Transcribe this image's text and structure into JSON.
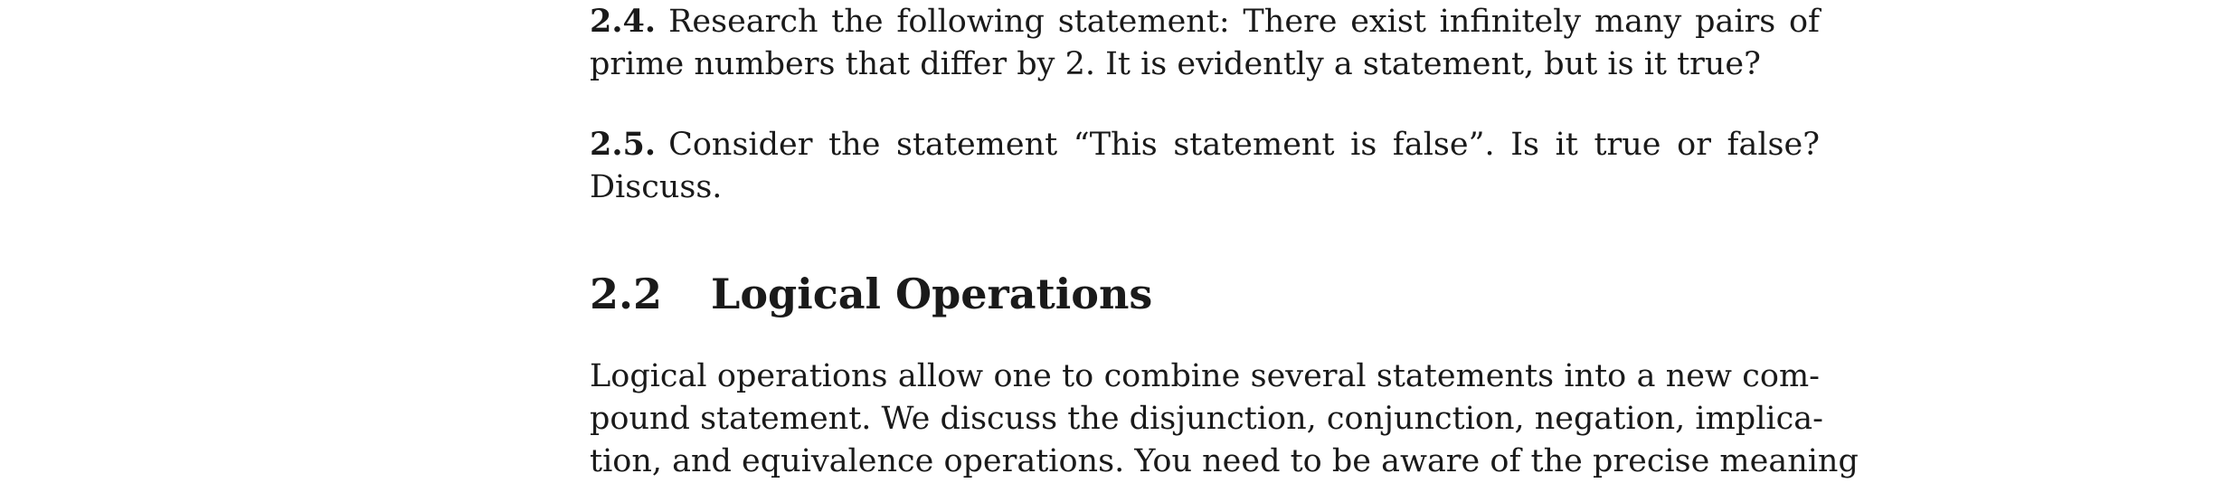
{
  "exercises": [
    {
      "number": "2.4.",
      "text": "Research the following statement: There exist infinitely many pairs of prime numbers that differ by 2. It is evidently a statement, but is it true?"
    },
    {
      "number": "2.5.",
      "text": "Consider the statement “This statement is false”. Is it true or false? Discuss."
    }
  ],
  "section": {
    "number": "2.2",
    "title": "Logical Operations"
  },
  "body_lines": [
    "Logical operations allow one to combine several statements into a new com-",
    "pound statement. We discuss the disjunction, conjunction, negation, implica-",
    "tion, and equivalence operations. You need to be aware of the precise meaning"
  ]
}
